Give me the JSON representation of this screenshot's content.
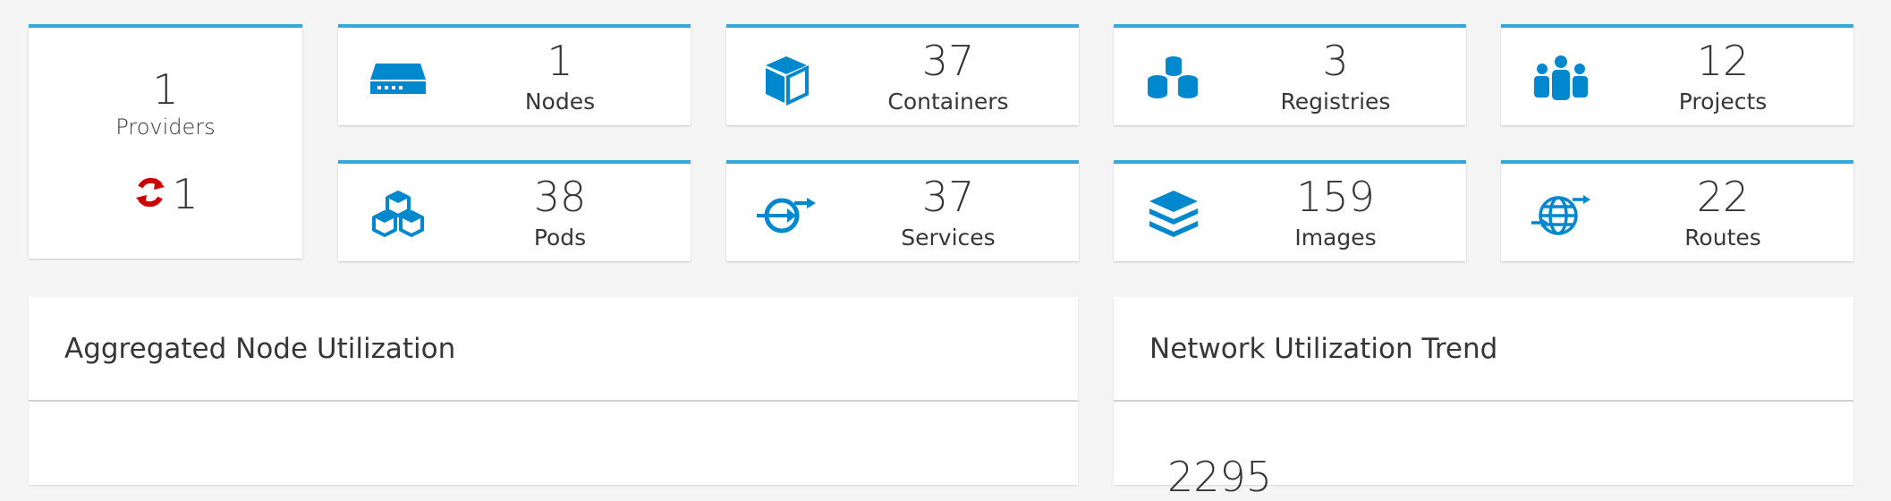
{
  "providers": {
    "count": "1",
    "label": "Providers",
    "status_count": "1",
    "status_icon": "refresh-icon",
    "status_color": "#cc0000"
  },
  "tiles": [
    {
      "count": "1",
      "label": "Nodes",
      "icon": "server-icon"
    },
    {
      "count": "37",
      "label": "Containers",
      "icon": "cube-icon"
    },
    {
      "count": "3",
      "label": "Registries",
      "icon": "registry-icon"
    },
    {
      "count": "12",
      "label": "Projects",
      "icon": "users-icon"
    },
    {
      "count": "38",
      "label": "Pods",
      "icon": "cubes-icon"
    },
    {
      "count": "37",
      "label": "Services",
      "icon": "service-icon"
    },
    {
      "count": "159",
      "label": "Images",
      "icon": "layers-icon"
    },
    {
      "count": "22",
      "label": "Routes",
      "icon": "globe-icon"
    }
  ],
  "panels": {
    "node_utilization": {
      "title": "Aggregated Node Utilization"
    },
    "network_trend": {
      "title": "Network Utilization Trend",
      "partial_value": "2295"
    }
  },
  "colors": {
    "accent": "#39a5dc",
    "icon": "#0088ce",
    "error": "#cc0000",
    "background": "#f5f5f5"
  }
}
